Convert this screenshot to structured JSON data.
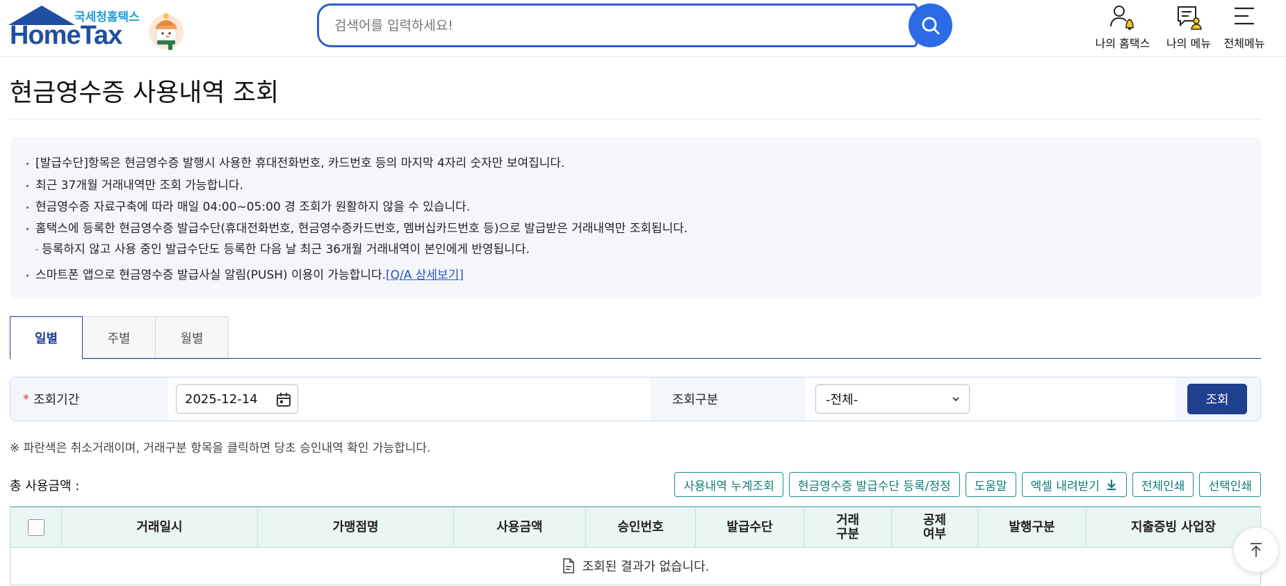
{
  "header": {
    "logo_sub": "국세청홈택스",
    "logo_main": "HomeTax",
    "search_placeholder": "검색어를 입력하세요!",
    "utils": [
      {
        "label": "나의 홈택스",
        "icon": "user-bell-icon"
      },
      {
        "label": "나의 메뉴",
        "icon": "menu-person-icon"
      },
      {
        "label": "전체메뉴",
        "icon": "hamburger-icon"
      }
    ]
  },
  "page": {
    "title": "현금영수증 사용내역 조회"
  },
  "notice": {
    "items": [
      "[발급수단]항목은 현금영수증 발행시 사용한 휴대전화번호, 카드번호 등의 마지막 4자리 숫자만 보여집니다.",
      "최근 37개월 거래내역만 조회 가능합니다.",
      "현금영수증 자료구축에 따라 매일 04:00~05:00 경 조회가 원활하지 않을 수 있습니다.",
      "홈택스에 등록한 현금영수증 발급수단(휴대전화번호, 현금영수증카드번호, 멤버십카드번호 등)으로 발급받은 거래내역만 조회됩니다.",
      "스마트폰 앱으로 현금영수증 발급사실 알림(PUSH) 이용이 가능합니다."
    ],
    "sub_item": "등록하지 않고 사용 중인 발급수단도 등록한 다음 날 최근 36개월 거래내역이 본인에게 반영됩니다.",
    "link": "[Q/A 상세보기]"
  },
  "tabs": [
    {
      "label": "일별",
      "active": true
    },
    {
      "label": "주별",
      "active": false
    },
    {
      "label": "월별",
      "active": false
    }
  ],
  "filter": {
    "required_mark": "*",
    "period_label": "조회기간",
    "date_value": "2025-12-14",
    "type_label": "조회구분",
    "type_value": "-전체-",
    "query_button": "조회"
  },
  "hint": "※ 파란색은 취소거래이며, 거래구분 항목을 클릭하면 당초 승인내역 확인 가능합니다.",
  "total_label": "총 사용금액 :",
  "actions": [
    "사용내역 누계조회",
    "현금영수증 발급수단 등록/정정",
    "도움말",
    "엑셀 내려받기",
    "전체인쇄",
    "선택인쇄"
  ],
  "table": {
    "columns": [
      "거래일시",
      "가맹점명",
      "사용금액",
      "승인번호",
      "발급수단",
      "거래\n구분",
      "공제\n여부",
      "발행구분",
      "지출증빙 사업장"
    ],
    "empty_text": "조회된 결과가 없습니다."
  },
  "colors": {
    "brand_blue": "#1f4fa3",
    "search_blue": "#2b6be6",
    "teal": "#117a75",
    "navy": "#1f3f8f"
  }
}
